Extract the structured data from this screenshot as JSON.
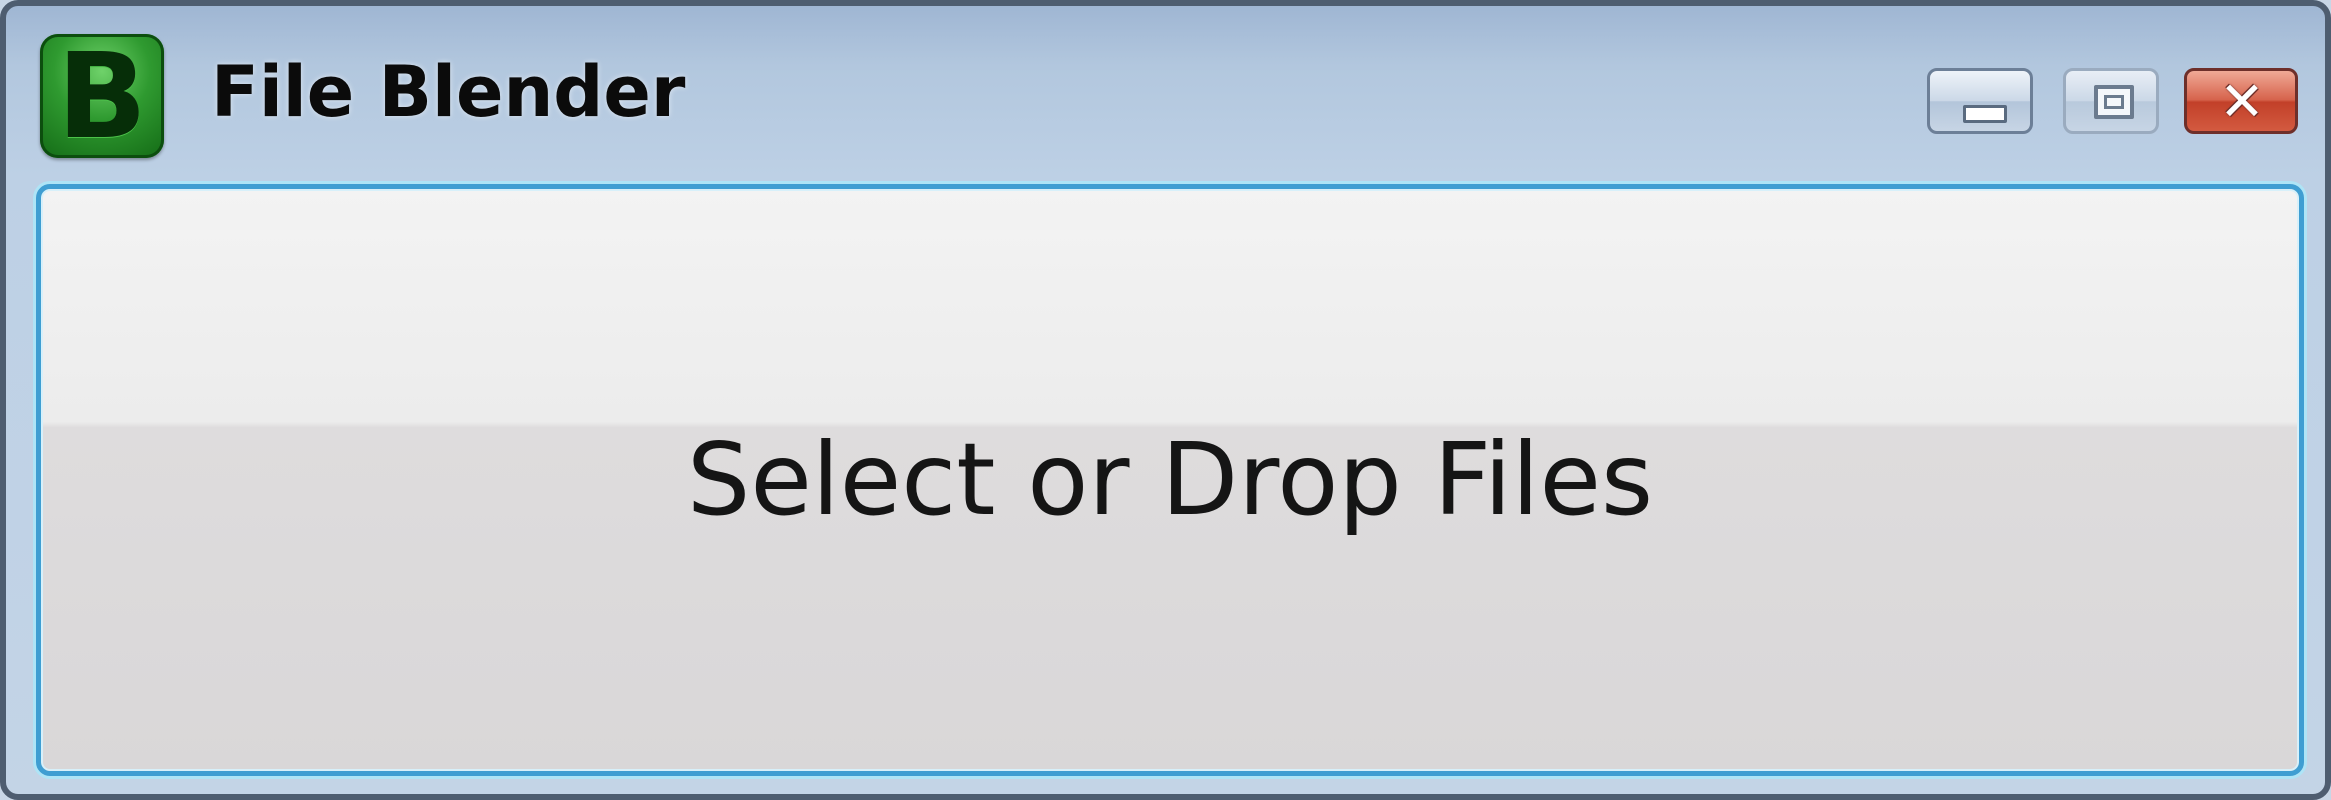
{
  "window": {
    "title": "File Blender",
    "app_icon_letter": "B",
    "app_icon_name": "file-blender-app-icon",
    "controls": {
      "minimize_icon": "minimize-icon",
      "maximize_icon": "maximize-icon",
      "close_icon": "close-icon",
      "close_glyph": "✕"
    }
  },
  "main": {
    "drop_button_label": "Select or Drop Files"
  },
  "colors": {
    "accent_border": "#3f9ed2",
    "close_red": "#c24029",
    "icon_green": "#2f9a30"
  }
}
